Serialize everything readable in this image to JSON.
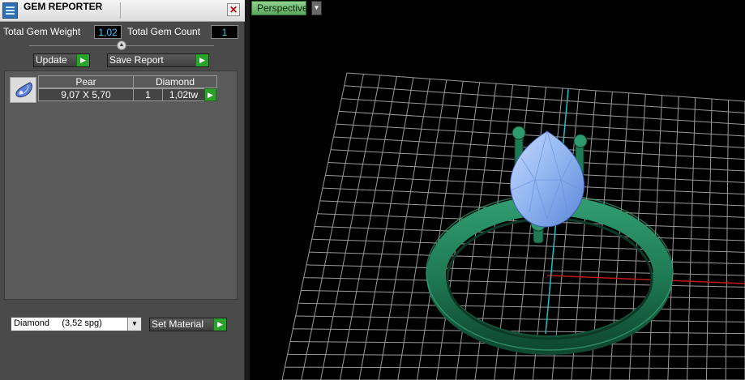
{
  "panel": {
    "title": "GEM REPORTER",
    "close_symbol": "✕",
    "total_weight_label": "Total Gem Weight",
    "total_weight_value": "1,02",
    "total_count_label": "Total Gem Count",
    "total_count_value": "1",
    "update_label": "Update",
    "save_report_label": "Save Report",
    "gems": [
      {
        "shape": "Pear",
        "material": "Diamond",
        "size": "9,07 X 5,70",
        "count": "1",
        "weight": "1,02tw"
      }
    ],
    "material_select": {
      "value": "Diamond     (3,52 spg)"
    },
    "set_material_label": "Set Material"
  },
  "viewport": {
    "label": "Perspective",
    "menu_symbol": "▼"
  },
  "colors": {
    "panel_bg": "#4a4a4a",
    "accent_green": "#29a329",
    "value_cyan": "#36c8ff",
    "ring_green": "#1f7a55",
    "gem_blue": "#8fb4f0",
    "grid": "#9a9a9a",
    "axis_x": "#c01818",
    "axis_z": "#20c0c8"
  },
  "icons": [
    "gem-reporter-app-icon",
    "close-icon",
    "collapse-arrow-icon",
    "play-arrow-icon",
    "dropdown-arrow-icon",
    "pear-gem-icon"
  ]
}
